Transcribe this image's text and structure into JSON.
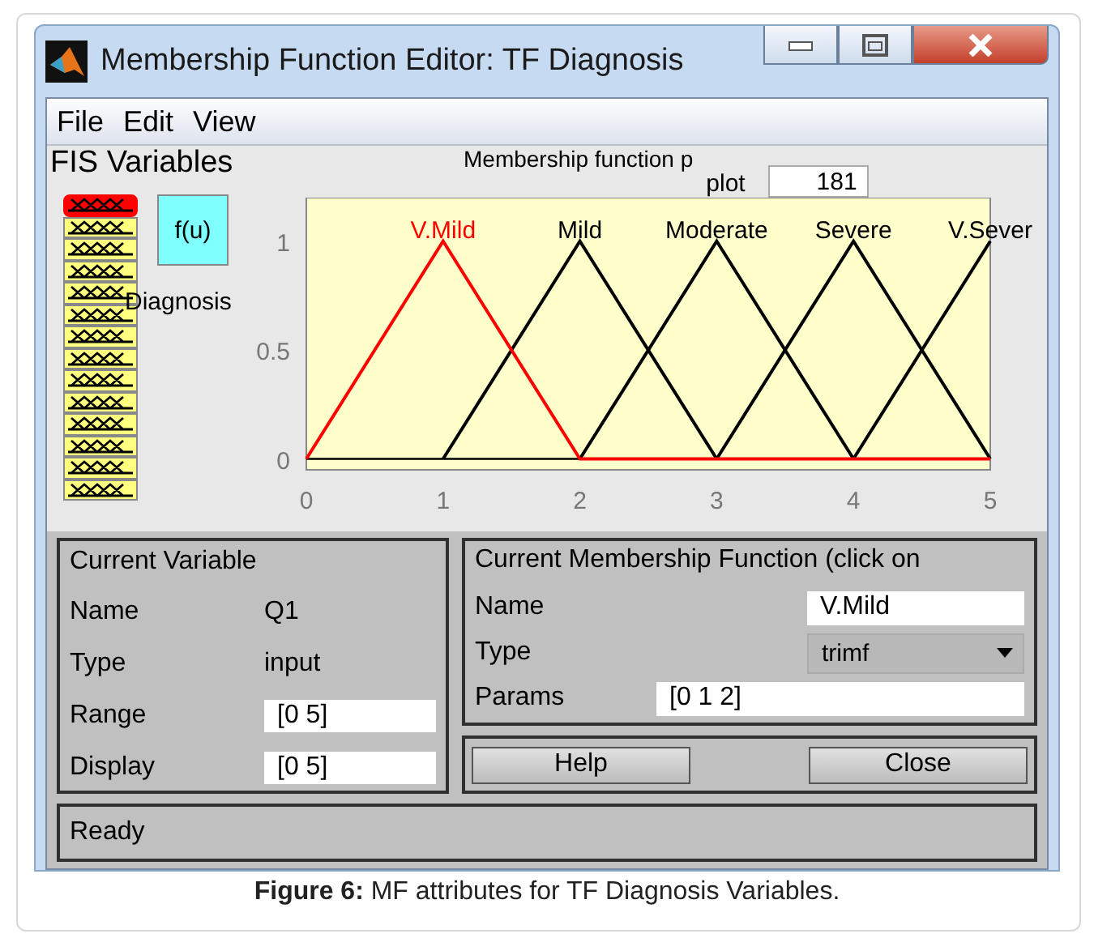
{
  "window": {
    "title": "Membership Function Editor: TF Diagnosis"
  },
  "menu": [
    "File",
    "Edit",
    "View"
  ],
  "fis_variables": {
    "title": "FIS Variables",
    "inputs": [
      {
        "selected": true
      },
      {
        "selected": false
      },
      {
        "selected": false
      },
      {
        "selected": false
      },
      {
        "selected": false
      },
      {
        "selected": false
      },
      {
        "selected": false
      },
      {
        "selected": false
      },
      {
        "selected": false
      },
      {
        "selected": false
      },
      {
        "selected": false
      },
      {
        "selected": false
      },
      {
        "selected": false
      },
      {
        "selected": false
      }
    ],
    "output": {
      "label": "f(u)",
      "name": "Diagnosis"
    }
  },
  "plot": {
    "title": "Membership function p",
    "points_label": "plot",
    "points": "181",
    "chart_data": {
      "type": "line",
      "x": [
        0,
        1,
        2,
        3,
        4,
        5
      ],
      "xlim": [
        0,
        5
      ],
      "ylim": [
        -0.05,
        1.2
      ],
      "xticks": [
        0,
        1,
        2,
        3,
        4,
        5
      ],
      "yticks": [
        0,
        0.5,
        1
      ],
      "series": [
        {
          "name": "V.Mild",
          "color": "#ff0000",
          "values": [
            0,
            1,
            0,
            0,
            0,
            0
          ]
        },
        {
          "name": "Mild",
          "color": "#000000",
          "values": [
            null,
            0,
            1,
            0,
            null,
            null
          ]
        },
        {
          "name": "Moderate",
          "color": "#000000",
          "values": [
            null,
            null,
            0,
            1,
            0,
            null
          ]
        },
        {
          "name": "Severe",
          "color": "#000000",
          "values": [
            null,
            null,
            null,
            0,
            1,
            0
          ]
        },
        {
          "name": "V.Sever",
          "color": "#000000",
          "values": [
            null,
            null,
            null,
            null,
            0,
            1
          ]
        }
      ]
    }
  },
  "current_variable": {
    "title": "Current Variable",
    "name_label": "Name",
    "name": "Q1",
    "type_label": "Type",
    "type": "input",
    "range_label": "Range",
    "range": "[0 5]",
    "display_label": "Display",
    "display": "[0 5]"
  },
  "current_mf": {
    "title": "Current Membership Function (click on",
    "name_label": "Name",
    "name": "V.Mild",
    "type_label": "Type",
    "type": "trimf",
    "params_label": "Params",
    "params": "[0 1 2]"
  },
  "buttons": [
    "Help",
    "Close"
  ],
  "status": "Ready",
  "caption": "**Figure 6:** MF attributes for TF Diagnosis Variables."
}
